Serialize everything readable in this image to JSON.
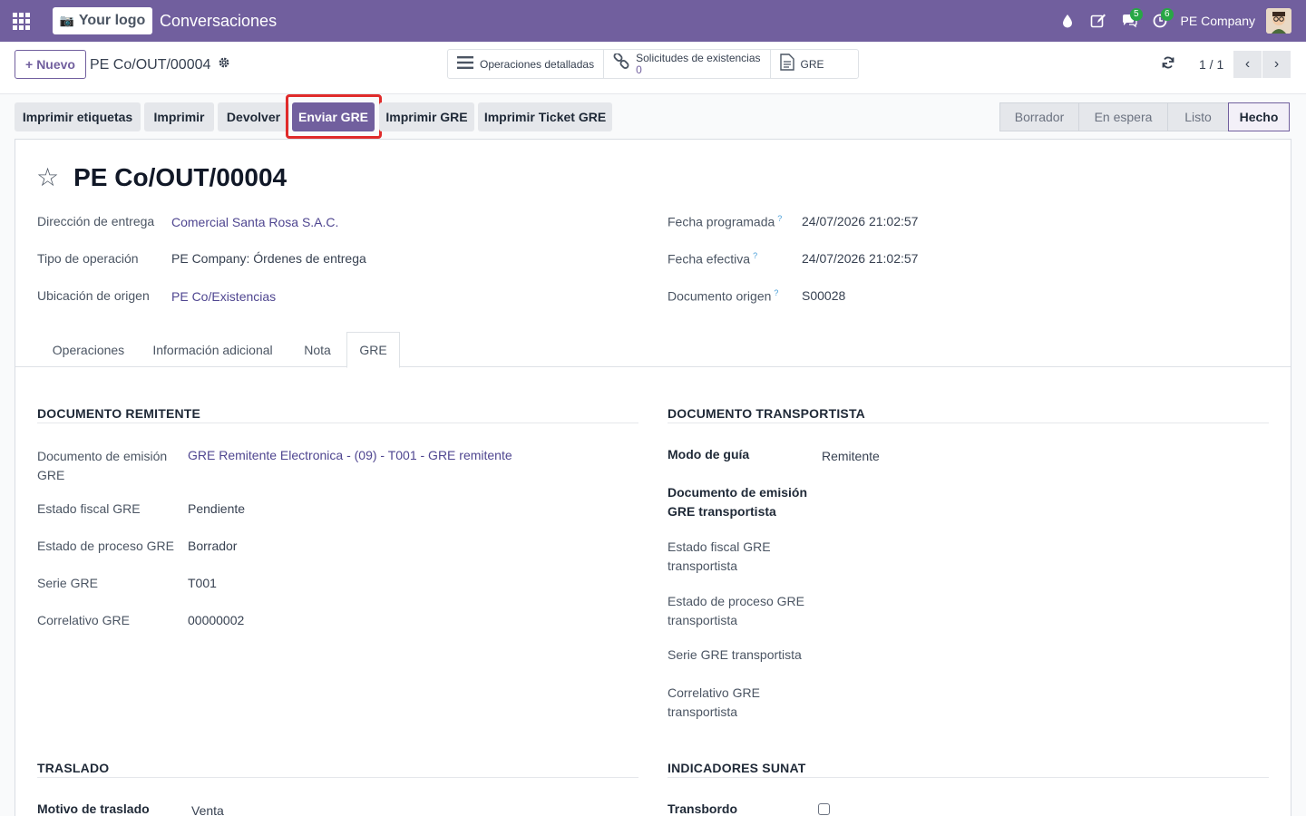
{
  "nav": {
    "logo_text": "Your logo",
    "app_title": "Conversaciones",
    "messages_count": "5",
    "activities_count": "6",
    "company": "PE Company"
  },
  "control": {
    "new_label": "Nuevo",
    "record_name": "PE Co/OUT/00004",
    "smart_ops": "Operaciones detalladas",
    "smart_requests": "Solicitudes de existencias",
    "smart_requests_count": "0",
    "smart_gre": "GRE",
    "pager": "1 / 1"
  },
  "actions": {
    "print_labels": "Imprimir etiquetas",
    "print": "Imprimir",
    "return": "Devolver",
    "send_gre": "Enviar GRE",
    "print_gre": "Imprimir GRE",
    "print_ticket_gre": "Imprimir Ticket GRE"
  },
  "statusbar": [
    "Borrador",
    "En espera",
    "Listo",
    "Hecho"
  ],
  "record": {
    "title": "PE Co/OUT/00004",
    "delivery_address_label": "Dirección de entrega",
    "delivery_address": "Comercial Santa Rosa S.A.C.",
    "operation_type_label": "Tipo de operación",
    "operation_type": "PE Company: Órdenes de entrega",
    "source_location_label": "Ubicación de origen",
    "source_location": "PE Co/Existencias",
    "scheduled_date_label": "Fecha programada",
    "scheduled_date": "24/07/2026 21:02:57",
    "effective_date_label": "Fecha efectiva",
    "effective_date": "24/07/2026 21:02:57",
    "origin_label": "Documento origen",
    "origin": "S00028",
    "help_mark": "?"
  },
  "tabs": [
    "Operaciones",
    "Información adicional",
    "Nota",
    "GRE"
  ],
  "gre": {
    "sender_title": "DOCUMENTO REMITENTE",
    "emission_doc_label": "Documento de emisión GRE",
    "emission_doc": "GRE Remitente Electronica - (09) - T001 - GRE remitente",
    "fiscal_state_label": "Estado fiscal GRE",
    "fiscal_state": "Pendiente",
    "process_state_label": "Estado de proceso GRE",
    "process_state": "Borrador",
    "series_label": "Serie GRE",
    "series": "T001",
    "correlative_label": "Correlativo GRE",
    "correlative": "00000002",
    "carrier_title": "DOCUMENTO TRANSPORTISTA",
    "guide_mode_label": "Modo de guía",
    "guide_mode": "Remitente",
    "carrier_doc_label": "Documento de emisión GRE transportista",
    "carrier_fiscal_label": "Estado fiscal GRE transportista",
    "carrier_process_label": "Estado de proceso GRE transportista",
    "carrier_series_label": "Serie GRE transportista",
    "carrier_correlative_label": "Correlativo GRE transportista",
    "transfer_title": "TRASLADO",
    "transfer_reason_label": "Motivo de traslado",
    "transfer_reason": "Venta",
    "sunat_title": "INDICADORES SUNAT",
    "transshipment_label": "Transbordo",
    "transshipment_checked": false
  },
  "colors": {
    "brand": "#715f9e",
    "highlight": "#e02b2b",
    "badge": "#28a745"
  }
}
